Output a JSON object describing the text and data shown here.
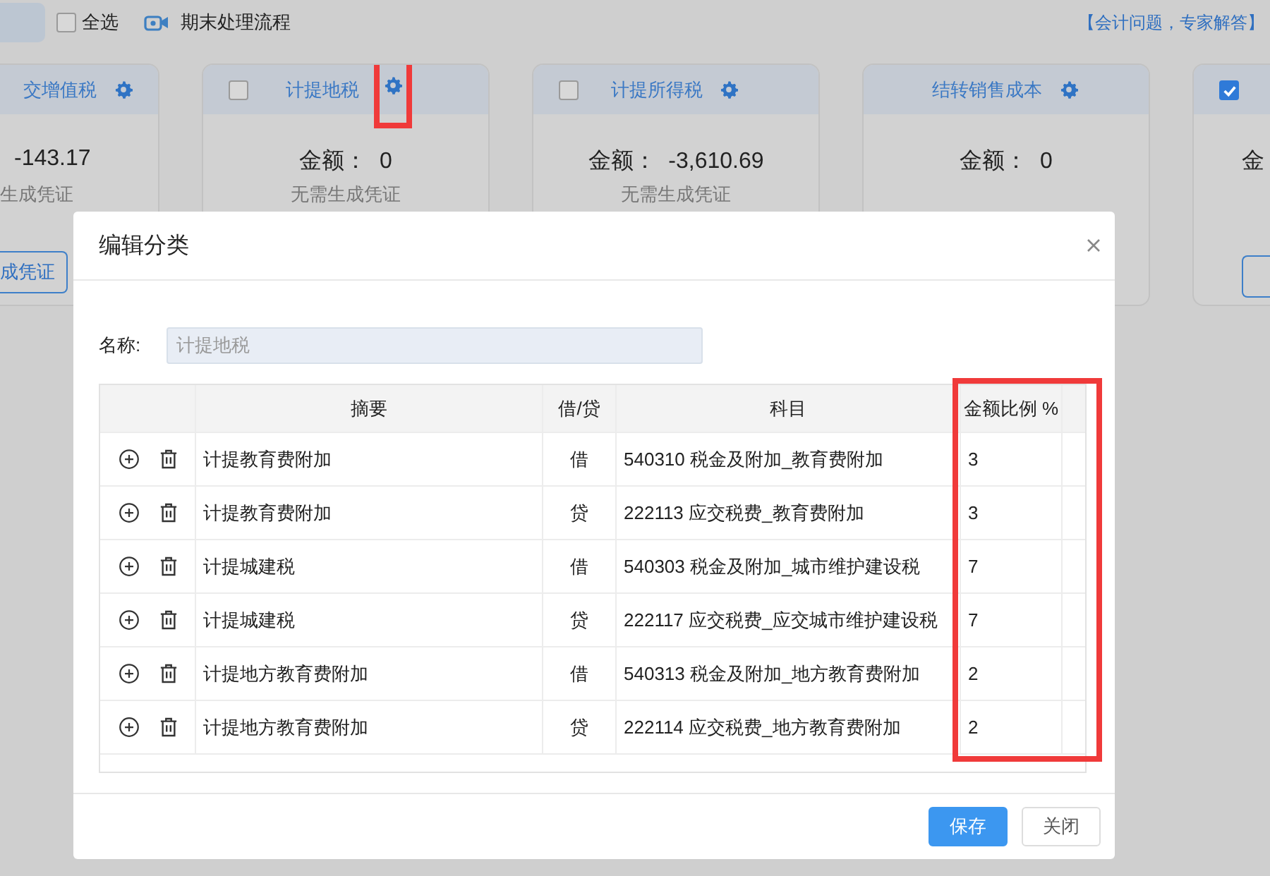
{
  "toolbar": {
    "select_all": {
      "label": "全选",
      "checked": false
    },
    "process_link": "期末处理流程",
    "help_link": "【会计问题，专家解答】"
  },
  "cards": [
    {
      "kind": "clipped-left",
      "title": "交增值税",
      "gear": true,
      "gear_highlighted": false,
      "amount": "-143.17",
      "status": "生成凭证",
      "button": "成凭证"
    },
    {
      "kind": "full",
      "title": "计提地税",
      "checked": false,
      "gear": true,
      "gear_highlighted": true,
      "amount_label": "金额：",
      "amount": "0",
      "status": "无需生成凭证"
    },
    {
      "kind": "full",
      "title": "计提所得税",
      "checked": false,
      "gear": true,
      "gear_highlighted": false,
      "amount_label": "金额：",
      "amount": "-3,610.69",
      "status": "无需生成凭证"
    },
    {
      "kind": "full",
      "title": "结转销售成本",
      "gear": true,
      "gear_highlighted": false,
      "amount_label": "金额：",
      "amount": "0"
    },
    {
      "kind": "clipped-right",
      "checked": true,
      "amount_label": "金",
      "empty_button": true
    }
  ],
  "dialog": {
    "title": "编辑分类",
    "name_label": "名称:",
    "name_value": "计提地税",
    "columns": [
      {
        "label": "摘要",
        "highlighted": false
      },
      {
        "label": "借/贷",
        "highlighted": false
      },
      {
        "label": "科目",
        "highlighted": false
      },
      {
        "label": "金额比例 %",
        "highlighted": true
      }
    ],
    "rows": [
      {
        "summary": "计提教育费附加",
        "direction": "借",
        "account": "540310 税金及附加_教育费附加",
        "ratio": "3"
      },
      {
        "summary": "计提教育费附加",
        "direction": "贷",
        "account": "222113 应交税费_教育费附加",
        "ratio": "3"
      },
      {
        "summary": "计提城建税",
        "direction": "借",
        "account": "540303 税金及附加_城市维护建设税",
        "ratio": "7"
      },
      {
        "summary": "计提城建税",
        "direction": "贷",
        "account": "222117 应交税费_应交城市维护建设税",
        "ratio": "7"
      },
      {
        "summary": "计提地方教育费附加",
        "direction": "借",
        "account": "540313 税金及附加_地方教育费附加",
        "ratio": "2"
      },
      {
        "summary": "计提地方教育费附加",
        "direction": "贷",
        "account": "222114 应交税费_地方教育费附加",
        "ratio": "2"
      }
    ],
    "buttons": [
      {
        "label": "保存",
        "kind": "primary"
      },
      {
        "label": "关闭",
        "kind": "default"
      }
    ]
  }
}
